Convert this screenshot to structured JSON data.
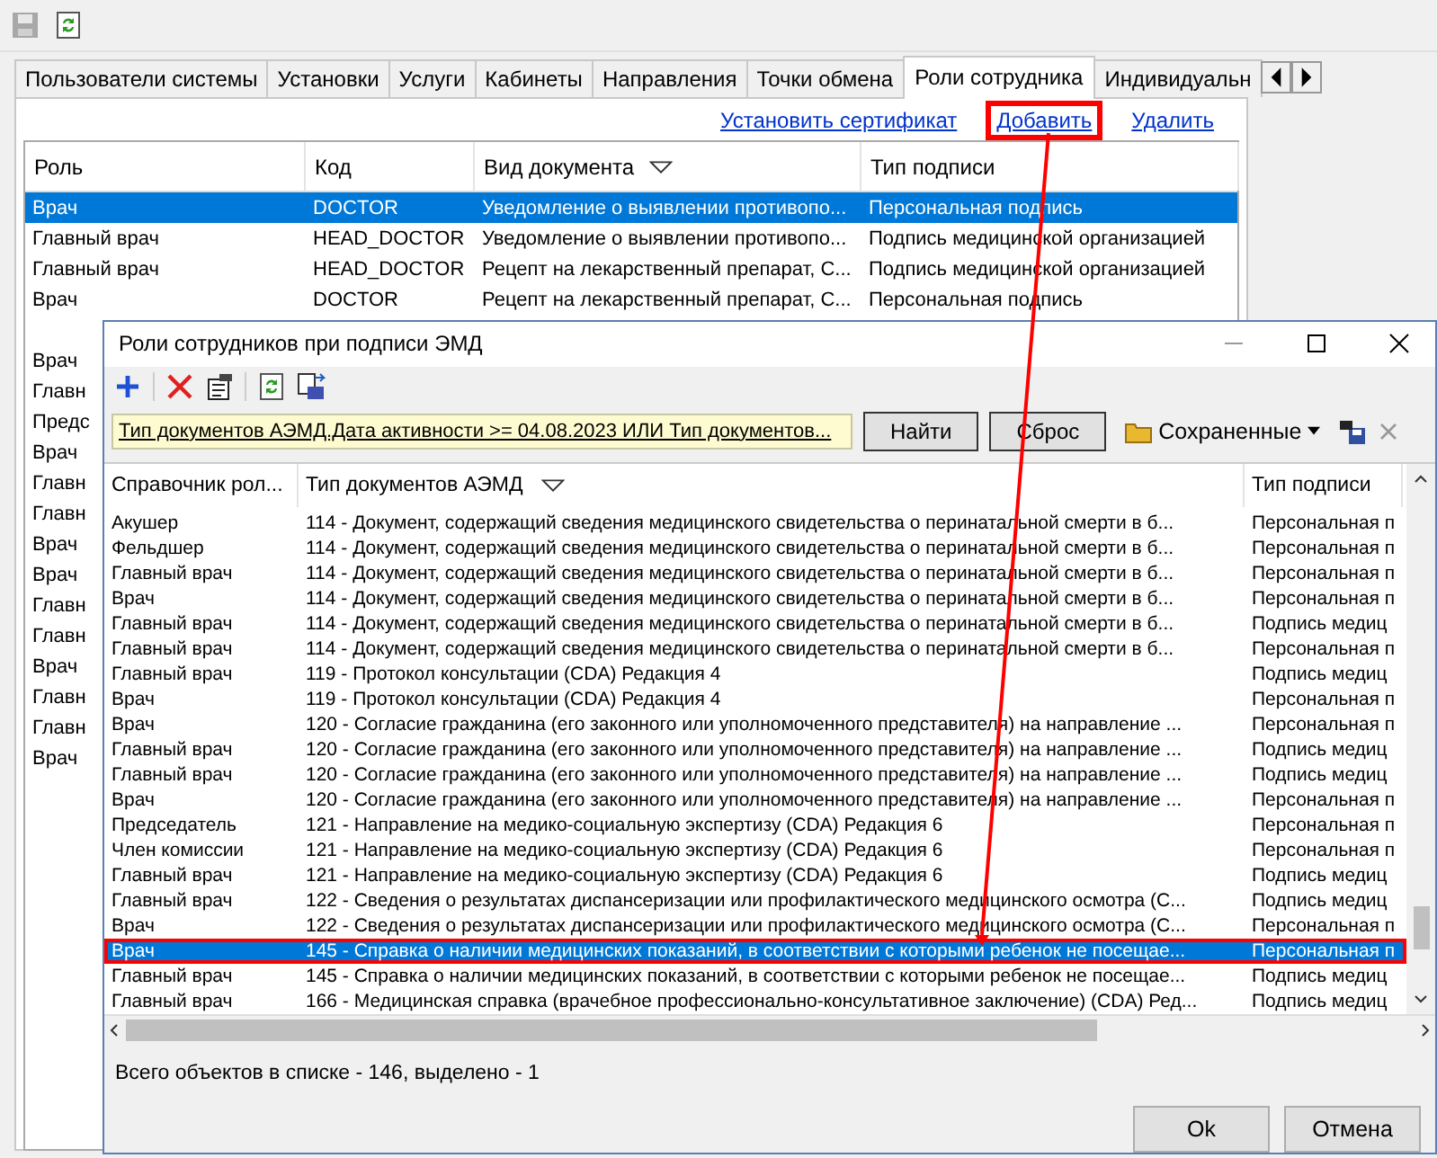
{
  "tabs": [
    {
      "label": "Пользователи системы",
      "selected": false
    },
    {
      "label": "Установки",
      "selected": false
    },
    {
      "label": "Услуги",
      "selected": false
    },
    {
      "label": "Кабинеты",
      "selected": false
    },
    {
      "label": "Направления",
      "selected": false
    },
    {
      "label": "Точки обмена",
      "selected": false
    },
    {
      "label": "Роли сотрудника",
      "selected": true
    },
    {
      "label": "Индивидуальн",
      "selected": false
    }
  ],
  "actions": [
    {
      "label": "Установить сертификат",
      "highlighted": false
    },
    {
      "label": "Добавить",
      "highlighted": true
    },
    {
      "label": "Удалить",
      "highlighted": false
    }
  ],
  "table": {
    "columns": [
      {
        "label": "Роль",
        "sorted": false
      },
      {
        "label": "Код",
        "sorted": false
      },
      {
        "label": "Вид документа",
        "sorted": true
      },
      {
        "label": "Тип подписи",
        "sorted": false
      }
    ],
    "rows": [
      {
        "cells": [
          "Врач",
          "DOCTOR",
          "Уведомление о выявлении противопо...",
          "Персональная подпись"
        ],
        "selected": true
      },
      {
        "cells": [
          "Главный врач",
          "HEAD_DOCTOR",
          "Уведомление о выявлении противопо...",
          "Подпись медицинской организацией"
        ],
        "selected": false
      },
      {
        "cells": [
          "Главный врач",
          "HEAD_DOCTOR",
          "Рецепт на лекарственный препарат, С...",
          "Подпись медицинской организацией"
        ],
        "selected": false
      },
      {
        "cells": [
          "Врач",
          "DOCTOR",
          "Рецепт на лекарственный препарат, С...",
          "Персональная подпись"
        ],
        "selected": false
      }
    ],
    "covered_rows": [
      "Врач",
      "Главн",
      "Предс",
      "Врач",
      "Главн",
      "Главн",
      "Врач",
      "Врач",
      "Главн",
      "Главн",
      "Врач",
      "Главн",
      "Главн",
      "Врач"
    ]
  },
  "dialog": {
    "title": "Роли сотрудников при подписи ЭМД",
    "filter": {
      "value": "Тип документов АЭМД.Дата активности >= 04.08.2023 ИЛИ Тип документов..."
    },
    "find_button": "Найти",
    "reset_button": "Сброс",
    "saved_label": "Сохраненные",
    "columns": [
      {
        "label": "Справочник рол..."
      },
      {
        "label": "Тип документов АЭМД",
        "sorted": true
      },
      {
        "label": "Тип подписи"
      }
    ],
    "rows": [
      {
        "cells": [
          "Акушер",
          "114 - Документ, содержащий сведения медицинского свидетельства о перинатальной смерти в б...",
          "Персональная п"
        ],
        "selected": false
      },
      {
        "cells": [
          "Фельдшер",
          "114 - Документ, содержащий сведения медицинского свидетельства о перинатальной смерти в б...",
          "Персональная п"
        ],
        "selected": false
      },
      {
        "cells": [
          "Главный врач",
          "114 - Документ, содержащий сведения медицинского свидетельства о перинатальной смерти в б...",
          "Персональная п"
        ],
        "selected": false
      },
      {
        "cells": [
          "Врач",
          "114 - Документ, содержащий сведения медицинского свидетельства о перинатальной смерти в б...",
          "Персональная п"
        ],
        "selected": false
      },
      {
        "cells": [
          "Главный врач",
          "114 - Документ, содержащий сведения медицинского свидетельства о перинатальной смерти в б...",
          "Подпись медиц"
        ],
        "selected": false
      },
      {
        "cells": [
          "Главный врач",
          "114 - Документ, содержащий сведения медицинского свидетельства о перинатальной смерти в б...",
          "Персональная п"
        ],
        "selected": false
      },
      {
        "cells": [
          "Главный врач",
          "119 - Протокол консультации (CDA) Редакция 4",
          "Подпись медиц"
        ],
        "selected": false
      },
      {
        "cells": [
          "Врач",
          "119 - Протокол консультации (CDA) Редакция 4",
          "Персональная п"
        ],
        "selected": false
      },
      {
        "cells": [
          "Врач",
          "120 - Согласие гражданина (его законного или уполномоченного представителя) на направление ...",
          "Персональная п"
        ],
        "selected": false
      },
      {
        "cells": [
          "Главный врач",
          "120 - Согласие гражданина (его законного или уполномоченного представителя) на направление ...",
          "Подпись медиц"
        ],
        "selected": false
      },
      {
        "cells": [
          "Главный врач",
          "120 - Согласие гражданина (его законного или уполномоченного представителя) на направление ...",
          "Подпись медиц"
        ],
        "selected": false
      },
      {
        "cells": [
          "Врач",
          "120 - Согласие гражданина (его законного или уполномоченного представителя) на направление ...",
          "Персональная п"
        ],
        "selected": false
      },
      {
        "cells": [
          "Председатель",
          "121 - Направление на медико-социальную экспертизу (CDA) Редакция 6",
          "Персональная п"
        ],
        "selected": false
      },
      {
        "cells": [
          "Член комиссии",
          "121 - Направление на медико-социальную экспертизу (CDA) Редакция 6",
          "Персональная п"
        ],
        "selected": false
      },
      {
        "cells": [
          "Главный врач",
          "121 - Направление на медико-социальную экспертизу (CDA) Редакция 6",
          "Подпись медиц"
        ],
        "selected": false
      },
      {
        "cells": [
          "Главный врач",
          "122 - Сведения о результатах диспансеризации или профилактического медицинского осмотра (С...",
          "Подпись медиц"
        ],
        "selected": false
      },
      {
        "cells": [
          "Врач",
          "122 - Сведения о результатах диспансеризации или профилактического медицинского осмотра (С...",
          "Персональная п"
        ],
        "selected": false
      },
      {
        "cells": [
          "Врач",
          "145 - Справка о наличии медицинских показаний, в соответствии с которыми ребенок не посещае...",
          "Персональная п"
        ],
        "selected": true,
        "highlighted": true
      },
      {
        "cells": [
          "Главный врач",
          "145 - Справка о наличии медицинских показаний, в соответствии с которыми ребенок не посещае...",
          "Подпись медиц"
        ],
        "selected": false
      },
      {
        "cells": [
          "Главный врач",
          "166 - Медицинская справка (врачебное профессионально-консультативное заключение) (CDA) Ред...",
          "Подпись медиц"
        ],
        "selected": false
      }
    ],
    "status": "Всего объектов в списке - 146, выделено - 1",
    "ok_button": "Ok",
    "cancel_button": "Отмена"
  }
}
